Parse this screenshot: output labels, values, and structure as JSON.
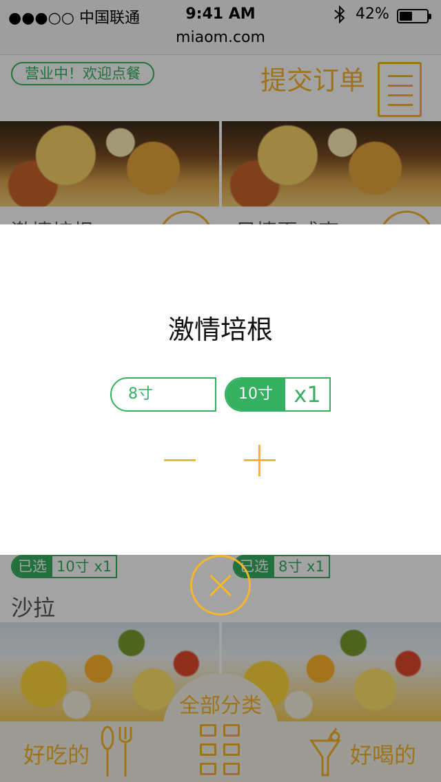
{
  "status_bar": {
    "carrier": "●●●○○ 中国联通",
    "time": "9:41 AM",
    "battery": "42%",
    "url": "miaom.com"
  },
  "header": {
    "open_badge": "营业中！欢迎点餐",
    "submit_order": "提交订单"
  },
  "menu": {
    "items": [
      {
        "name": "激情培根",
        "selected_label": "已选",
        "selected_value": "10寸 x1"
      },
      {
        "name": "风情夏威夷",
        "selected_label": "已选",
        "selected_value": "8寸 x1"
      }
    ],
    "salad_section": "沙拉"
  },
  "bottom_nav": {
    "left": "好吃的",
    "center": "全部分类",
    "right": "好喝的"
  },
  "modal": {
    "title": "激情培根",
    "option_8": "8寸",
    "option_10": "10寸",
    "option_10_qty": "x1"
  },
  "colors": {
    "accent": "#f7b52c",
    "green": "#34b060"
  }
}
